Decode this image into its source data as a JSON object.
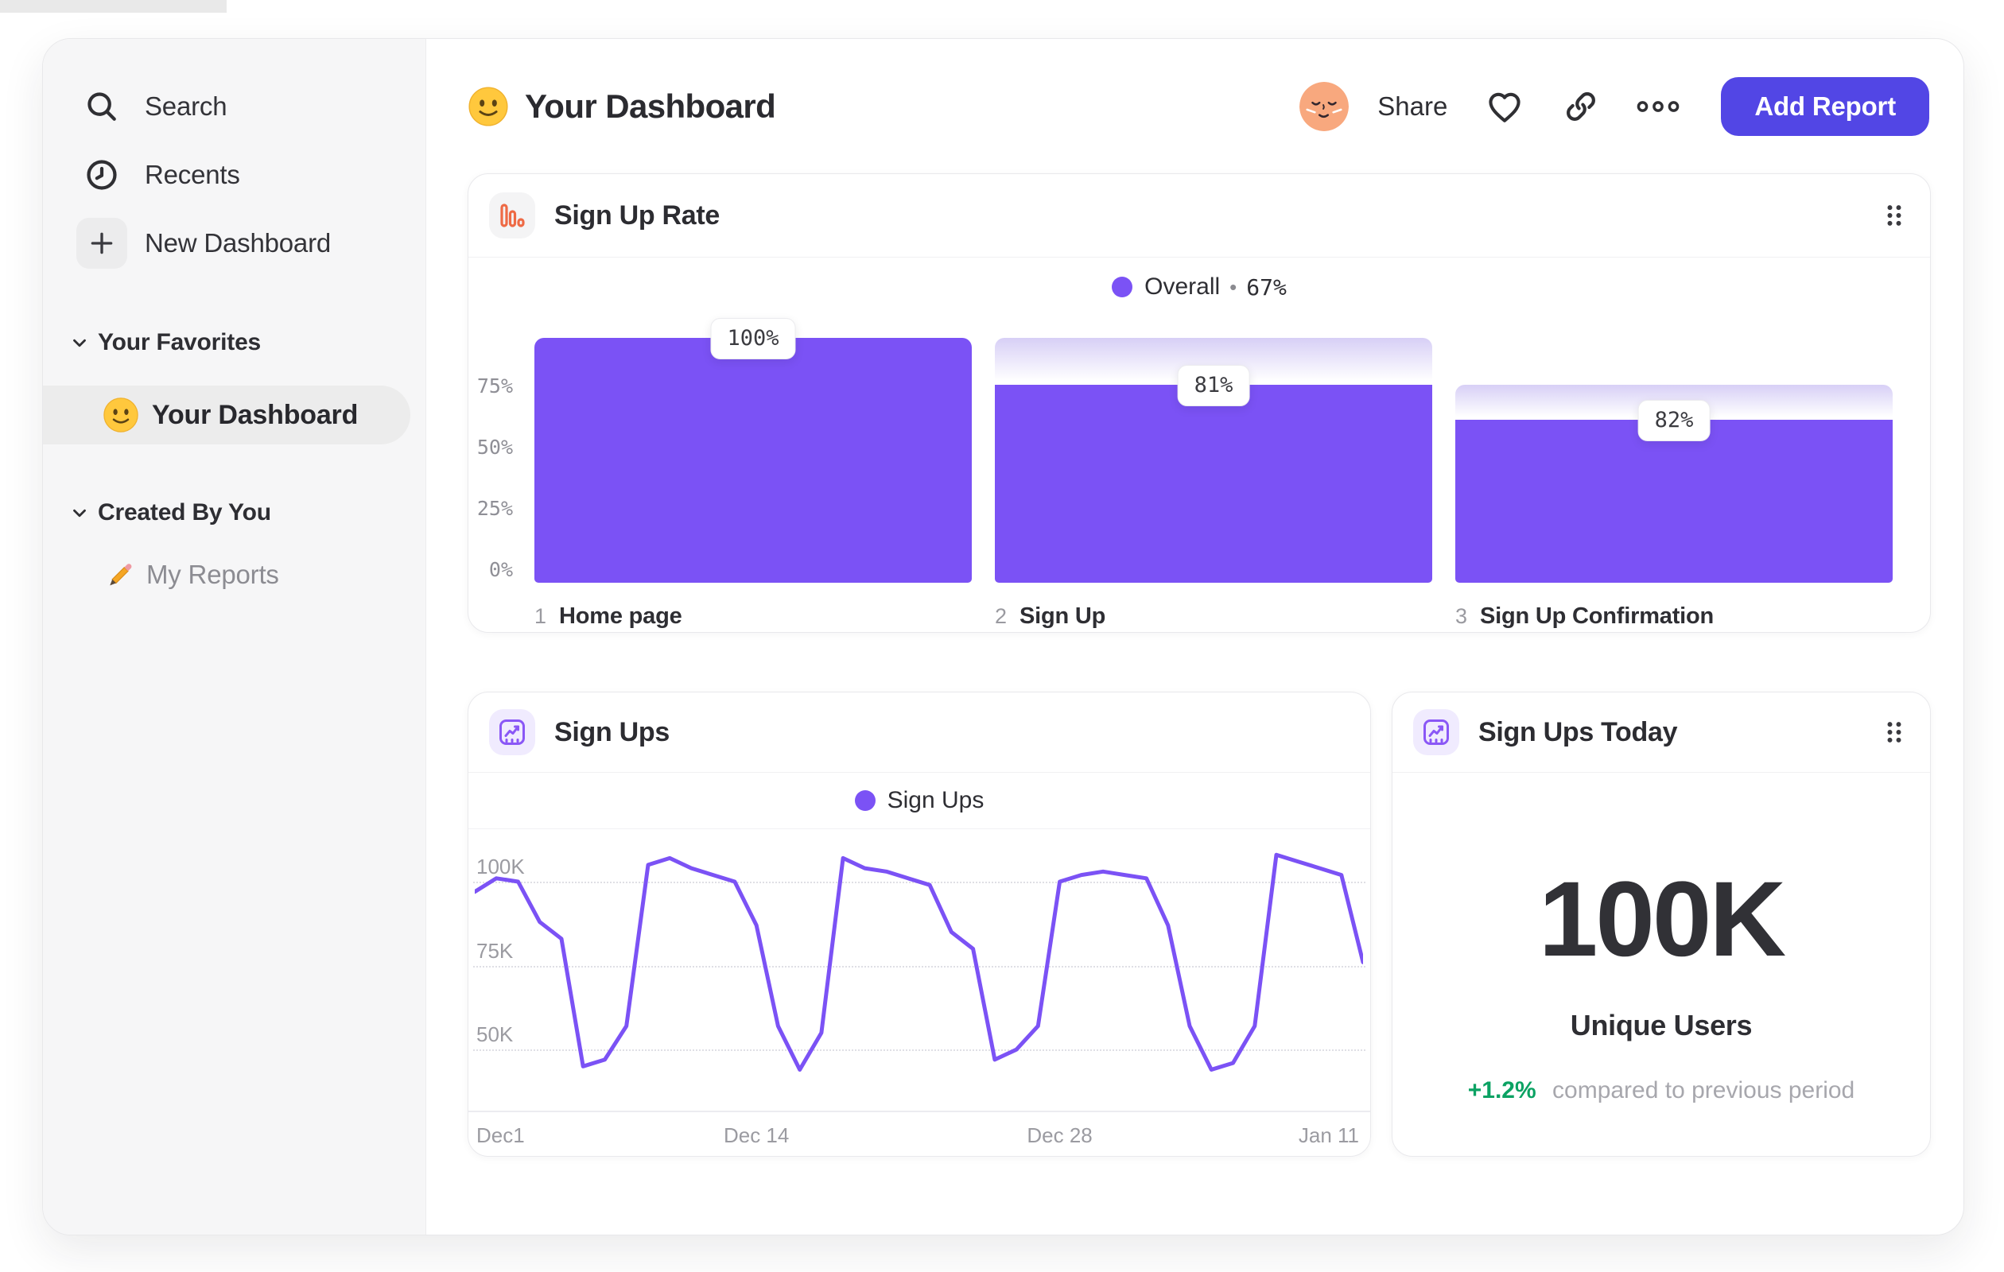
{
  "colors": {
    "accent": "#7b52f5",
    "funnel_cap_top": "#d7cff6",
    "button": "#5246e5",
    "icon_orange": "#ee6a45",
    "icon_purple": "#8a57f6",
    "green": "#0ba263"
  },
  "sidebar": {
    "nav": [
      {
        "label": "Search",
        "icon": "search-icon"
      },
      {
        "label": "Recents",
        "icon": "clock-icon"
      },
      {
        "label": "New Dashboard",
        "icon": "plus-icon"
      }
    ],
    "sections": [
      {
        "title": "Your Favorites",
        "items": [
          {
            "label": "Your Dashboard",
            "icon": "smiley-emoji",
            "active": true
          }
        ]
      },
      {
        "title": "Created By You",
        "items": [
          {
            "label": "My Reports",
            "icon": "pencil-emoji",
            "active": false
          }
        ]
      }
    ]
  },
  "header": {
    "title": "Your Dashboard",
    "share_label": "Share",
    "add_report_label": "Add Report"
  },
  "chart_data": [
    {
      "type": "bar",
      "variant": "funnel",
      "title": "Sign Up Rate",
      "legend": {
        "label": "Overall",
        "separator": "•",
        "value": "67%"
      },
      "ylim": [
        0,
        100
      ],
      "y_ticks": [
        {
          "label": "75%",
          "value": 75
        },
        {
          "label": "50%",
          "value": 50
        },
        {
          "label": "25%",
          "value": 25
        },
        {
          "label": "0%",
          "value": 0
        }
      ],
      "steps": [
        {
          "number": "1",
          "category": "Home page",
          "conversion_label": "100%",
          "conversion_from_previous": 1.0,
          "cumulative": 1.0,
          "previous_cumulative": 1.0
        },
        {
          "number": "2",
          "category": "Sign Up",
          "conversion_label": "81%",
          "conversion_from_previous": 0.81,
          "cumulative": 0.81,
          "previous_cumulative": 1.0
        },
        {
          "number": "3",
          "category": "Sign Up Confirmation",
          "conversion_label": "82%",
          "conversion_from_previous": 0.82,
          "cumulative": 0.6642,
          "previous_cumulative": 0.81
        }
      ]
    },
    {
      "type": "line",
      "title": "Sign Ups",
      "legend": {
        "label": "Sign Ups"
      },
      "unit": "K users",
      "x_ticks": [
        {
          "label": "Dec1",
          "day": 0
        },
        {
          "label": "Dec 14",
          "day": 13
        },
        {
          "label": "Dec 28",
          "day": 27
        },
        {
          "label": "Jan 11",
          "day": 41
        }
      ],
      "y_ticks": [
        {
          "label": "100K",
          "value": 100
        },
        {
          "label": "75K",
          "value": 75
        },
        {
          "label": "50K",
          "value": 50
        }
      ],
      "x_range_days": 41,
      "values_k": [
        97,
        101,
        100,
        88,
        83,
        45,
        47,
        57,
        105,
        107,
        104,
        102,
        100,
        87,
        57,
        44,
        55,
        107,
        104,
        103,
        101,
        99,
        85,
        80,
        47,
        50,
        57,
        100,
        102,
        103,
        102,
        101,
        87,
        57,
        44,
        46,
        57,
        108,
        106,
        104,
        102,
        76
      ]
    },
    {
      "type": "number",
      "title": "Sign Ups Today",
      "value": "100K",
      "caption": "Unique Users",
      "delta": "+1.2%",
      "comparison": "compared to previous period"
    }
  ]
}
